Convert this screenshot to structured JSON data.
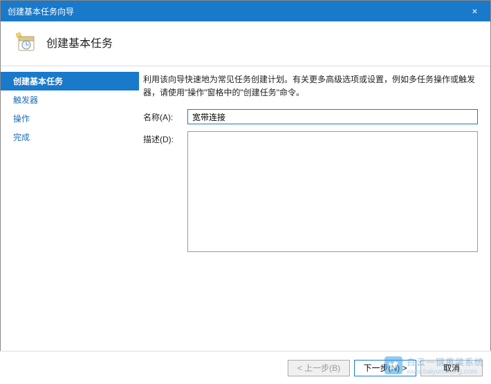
{
  "window": {
    "title": "创建基本任务向导",
    "close_label": "×"
  },
  "header": {
    "title": "创建基本任务"
  },
  "sidebar": {
    "items": [
      {
        "label": "创建基本任务",
        "selected": true
      },
      {
        "label": "触发器",
        "selected": false
      },
      {
        "label": "操作",
        "selected": false
      },
      {
        "label": "完成",
        "selected": false
      }
    ]
  },
  "content": {
    "instruction": "利用该向导快速地为常见任务创建计划。有关更多高级选项或设置，例如多任务操作或触发器，请使用\"操作\"窗格中的\"创建任务\"命令。",
    "name_label": "名称(A):",
    "name_value": "宽带连接",
    "desc_label": "描述(D):",
    "desc_value": ""
  },
  "footer": {
    "back": "< 上一步(B)",
    "next": "下一步(N) >",
    "cancel": "取消"
  },
  "watermark": {
    "text": "白云一键重装系统",
    "url": "www.baiyunxitong.com"
  }
}
